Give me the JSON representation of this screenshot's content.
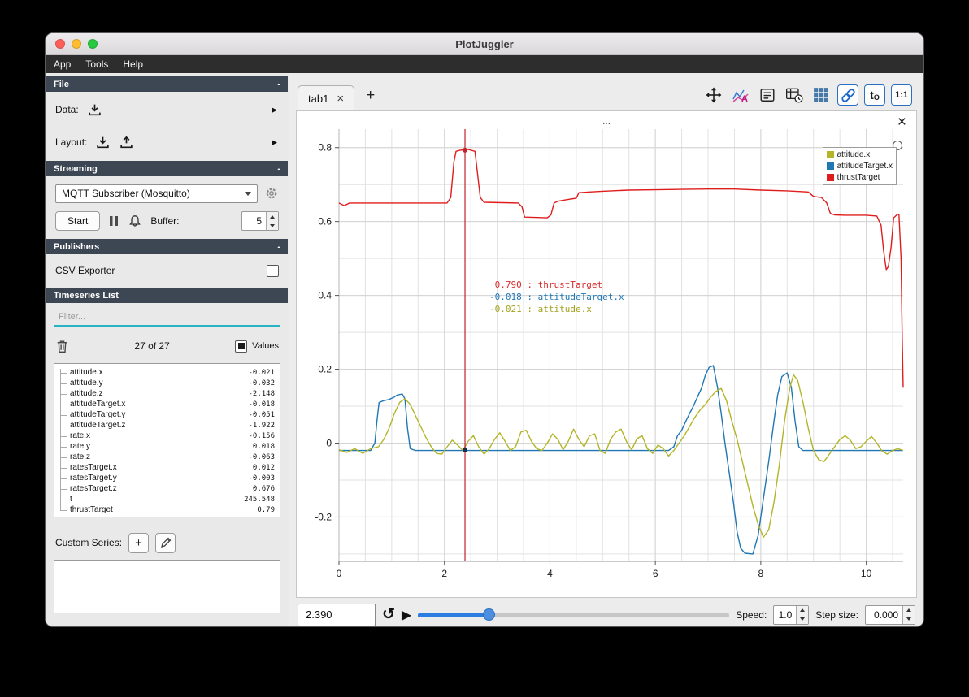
{
  "glyphs": {
    "minus": "-",
    "arrow_right": "▶",
    "close": "×",
    "add": "+",
    "play": "▶",
    "loop": "↺",
    "t0_main": "t",
    "t0_sub": "O",
    "ratio": "1:1"
  },
  "window": {
    "title": "PlotJuggler",
    "menu": [
      "App",
      "Tools",
      "Help"
    ]
  },
  "sidebar": {
    "file": {
      "title": "File",
      "data_label": "Data:",
      "layout_label": "Layout:"
    },
    "streaming": {
      "title": "Streaming",
      "source": "MQTT Subscriber (Mosquitto)",
      "start": "Start",
      "buffer_label": "Buffer:",
      "buffer_value": "5"
    },
    "publishers": {
      "title": "Publishers",
      "csv_exporter": "CSV Exporter"
    },
    "timeseries": {
      "title": "Timeseries List",
      "filter_placeholder": "Filter...",
      "count": "27 of 27",
      "values_label": "Values",
      "custom_series_label": "Custom Series:",
      "items": [
        {
          "name": "attitude.x",
          "value": "-0.021"
        },
        {
          "name": "attitude.y",
          "value": "-0.032"
        },
        {
          "name": "attitude.z",
          "value": "-2.148"
        },
        {
          "name": "attitudeTarget.x",
          "value": "-0.018"
        },
        {
          "name": "attitudeTarget.y",
          "value": "-0.051"
        },
        {
          "name": "attitudeTarget.z",
          "value": "-1.922"
        },
        {
          "name": "rate.x",
          "value": "-0.156"
        },
        {
          "name": "rate.y",
          "value": "0.018"
        },
        {
          "name": "rate.z",
          "value": "-0.063"
        },
        {
          "name": "ratesTarget.x",
          "value": "0.012"
        },
        {
          "name": "ratesTarget.y",
          "value": "-0.003"
        },
        {
          "name": "ratesTarget.z",
          "value": "0.676"
        },
        {
          "name": "t",
          "value": "245.548"
        },
        {
          "name": "thrustTarget",
          "value": "0.79"
        }
      ]
    }
  },
  "main": {
    "tab": {
      "label": "tab1"
    },
    "plot": {
      "title": "...",
      "legend": [
        {
          "label": "attitude.x",
          "color": "#b4b428"
        },
        {
          "label": "attitudeTarget.x",
          "color": "#1f77b4"
        },
        {
          "label": "thrustTarget",
          "color": "#e01d1d"
        }
      ],
      "tooltip": [
        {
          "value": "0.790",
          "label": "thrustTarget",
          "color": "#d92b2b"
        },
        {
          "value": "-0.018",
          "label": "attitudeTarget.x",
          "color": "#1f77b4"
        },
        {
          "value": "-0.021",
          "label": "attitude.x",
          "color": "#a2a21d"
        }
      ]
    },
    "playback": {
      "time": "2.390",
      "speed_label": "Speed:",
      "speed_value": "1.0",
      "step_label": "Step size:",
      "step_value": "0.000",
      "slider_fraction": 0.23
    }
  },
  "chart_data": {
    "type": "line",
    "title": "...",
    "xlabel": "",
    "ylabel": "",
    "xlim": [
      0,
      10.7
    ],
    "ylim": [
      -0.32,
      0.85
    ],
    "x_ticks": [
      0,
      2,
      4,
      6,
      8,
      10
    ],
    "y_ticks": [
      -0.2,
      0,
      0.2,
      0.4,
      0.6,
      0.8
    ],
    "x_minor_step": 0.5,
    "y_minor_step": 0.1,
    "grid": true,
    "legend_position": "top-right",
    "tracker": {
      "x": 2.39,
      "points": [
        {
          "y": 0.793,
          "color": "#c0242e"
        },
        {
          "y": -0.018,
          "color": "#16324f"
        }
      ]
    },
    "series": [
      {
        "name": "thrustTarget",
        "color": "#e01d1d",
        "points": [
          [
            0,
            0.65
          ],
          [
            0.1,
            0.643
          ],
          [
            0.2,
            0.65
          ],
          [
            1.0,
            0.65
          ],
          [
            2.05,
            0.65
          ],
          [
            2.12,
            0.665
          ],
          [
            2.18,
            0.762
          ],
          [
            2.22,
            0.79
          ],
          [
            2.3,
            0.793
          ],
          [
            2.45,
            0.795
          ],
          [
            2.58,
            0.79
          ],
          [
            2.62,
            0.74
          ],
          [
            2.68,
            0.665
          ],
          [
            2.75,
            0.652
          ],
          [
            3.4,
            0.65
          ],
          [
            3.47,
            0.64
          ],
          [
            3.52,
            0.612
          ],
          [
            3.95,
            0.61
          ],
          [
            4.02,
            0.618
          ],
          [
            4.08,
            0.65
          ],
          [
            4.15,
            0.655
          ],
          [
            4.35,
            0.66
          ],
          [
            4.5,
            0.663
          ],
          [
            4.55,
            0.678
          ],
          [
            4.75,
            0.68
          ],
          [
            5.0,
            0.682
          ],
          [
            5.5,
            0.685
          ],
          [
            6.0,
            0.686
          ],
          [
            6.5,
            0.687
          ],
          [
            7.0,
            0.688
          ],
          [
            7.5,
            0.688
          ],
          [
            8.0,
            0.685
          ],
          [
            8.5,
            0.683
          ],
          [
            8.9,
            0.68
          ],
          [
            9.0,
            0.668
          ],
          [
            9.15,
            0.665
          ],
          [
            9.25,
            0.65
          ],
          [
            9.32,
            0.622
          ],
          [
            9.4,
            0.618
          ],
          [
            9.6,
            0.617
          ],
          [
            10.0,
            0.617
          ],
          [
            10.2,
            0.615
          ],
          [
            10.28,
            0.59
          ],
          [
            10.33,
            0.52
          ],
          [
            10.38,
            0.47
          ],
          [
            10.42,
            0.478
          ],
          [
            10.47,
            0.53
          ],
          [
            10.52,
            0.61
          ],
          [
            10.58,
            0.618
          ],
          [
            10.62,
            0.62
          ],
          [
            10.66,
            0.5
          ],
          [
            10.68,
            0.3
          ],
          [
            10.7,
            0.15
          ]
        ]
      },
      {
        "name": "attitudeTarget.x",
        "color": "#1f77b4",
        "points": [
          [
            0,
            -0.02
          ],
          [
            0.6,
            -0.02
          ],
          [
            0.68,
            0.0
          ],
          [
            0.72,
            0.06
          ],
          [
            0.76,
            0.11
          ],
          [
            0.85,
            0.115
          ],
          [
            0.95,
            0.118
          ],
          [
            1.05,
            0.125
          ],
          [
            1.1,
            0.13
          ],
          [
            1.2,
            0.133
          ],
          [
            1.25,
            0.12
          ],
          [
            1.3,
            0.04
          ],
          [
            1.35,
            -0.015
          ],
          [
            1.45,
            -0.02
          ],
          [
            6.25,
            -0.02
          ],
          [
            6.35,
            -0.01
          ],
          [
            6.42,
            0.02
          ],
          [
            6.5,
            0.035
          ],
          [
            6.58,
            0.06
          ],
          [
            6.65,
            0.08
          ],
          [
            6.72,
            0.1
          ],
          [
            6.8,
            0.125
          ],
          [
            6.88,
            0.15
          ],
          [
            6.95,
            0.185
          ],
          [
            7.02,
            0.205
          ],
          [
            7.1,
            0.21
          ],
          [
            7.18,
            0.15
          ],
          [
            7.25,
            0.08
          ],
          [
            7.32,
            0.0
          ],
          [
            7.4,
            -0.08
          ],
          [
            7.48,
            -0.16
          ],
          [
            7.55,
            -0.24
          ],
          [
            7.62,
            -0.285
          ],
          [
            7.7,
            -0.298
          ],
          [
            7.85,
            -0.3
          ],
          [
            7.95,
            -0.25
          ],
          [
            8.05,
            -0.15
          ],
          [
            8.15,
            -0.05
          ],
          [
            8.25,
            0.06
          ],
          [
            8.32,
            0.13
          ],
          [
            8.4,
            0.18
          ],
          [
            8.5,
            0.19
          ],
          [
            8.58,
            0.15
          ],
          [
            8.65,
            0.06
          ],
          [
            8.72,
            -0.01
          ],
          [
            8.8,
            -0.02
          ],
          [
            10.7,
            -0.02
          ]
        ]
      },
      {
        "name": "attitude.x",
        "color": "#b4b428",
        "points": [
          [
            0,
            -0.018
          ],
          [
            0.15,
            -0.025
          ],
          [
            0.3,
            -0.015
          ],
          [
            0.45,
            -0.028
          ],
          [
            0.6,
            -0.015
          ],
          [
            0.75,
            -0.01
          ],
          [
            0.85,
            0.01
          ],
          [
            0.95,
            0.04
          ],
          [
            1.05,
            0.08
          ],
          [
            1.15,
            0.11
          ],
          [
            1.25,
            0.12
          ],
          [
            1.35,
            0.105
          ],
          [
            1.45,
            0.075
          ],
          [
            1.55,
            0.045
          ],
          [
            1.65,
            0.015
          ],
          [
            1.75,
            -0.01
          ],
          [
            1.85,
            -0.028
          ],
          [
            1.95,
            -0.03
          ],
          [
            2.05,
            -0.01
          ],
          [
            2.15,
            0.008
          ],
          [
            2.25,
            -0.005
          ],
          [
            2.35,
            -0.02
          ],
          [
            2.45,
            0.005
          ],
          [
            2.55,
            0.02
          ],
          [
            2.65,
            -0.01
          ],
          [
            2.75,
            -0.03
          ],
          [
            2.85,
            -0.015
          ],
          [
            2.95,
            0.01
          ],
          [
            3.05,
            0.028
          ],
          [
            3.15,
            0.005
          ],
          [
            3.25,
            -0.02
          ],
          [
            3.35,
            -0.01
          ],
          [
            3.45,
            0.03
          ],
          [
            3.55,
            0.035
          ],
          [
            3.65,
            0.005
          ],
          [
            3.75,
            -0.015
          ],
          [
            3.85,
            -0.02
          ],
          [
            3.95,
            0.0
          ],
          [
            4.05,
            0.025
          ],
          [
            4.15,
            0.01
          ],
          [
            4.25,
            -0.018
          ],
          [
            4.35,
            0.005
          ],
          [
            4.45,
            0.038
          ],
          [
            4.55,
            0.01
          ],
          [
            4.65,
            -0.01
          ],
          [
            4.75,
            0.02
          ],
          [
            4.85,
            0.025
          ],
          [
            4.95,
            -0.02
          ],
          [
            5.05,
            -0.028
          ],
          [
            5.15,
            0.01
          ],
          [
            5.25,
            0.03
          ],
          [
            5.35,
            0.038
          ],
          [
            5.45,
            0.005
          ],
          [
            5.55,
            -0.018
          ],
          [
            5.65,
            0.012
          ],
          [
            5.75,
            0.02
          ],
          [
            5.85,
            -0.015
          ],
          [
            5.95,
            -0.028
          ],
          [
            6.05,
            -0.005
          ],
          [
            6.15,
            -0.015
          ],
          [
            6.25,
            -0.035
          ],
          [
            6.35,
            -0.02
          ],
          [
            6.45,
            0.0
          ],
          [
            6.55,
            0.02
          ],
          [
            6.65,
            0.045
          ],
          [
            6.75,
            0.07
          ],
          [
            6.85,
            0.09
          ],
          [
            6.95,
            0.105
          ],
          [
            7.05,
            0.125
          ],
          [
            7.15,
            0.14
          ],
          [
            7.25,
            0.148
          ],
          [
            7.35,
            0.115
          ],
          [
            7.45,
            0.06
          ],
          [
            7.55,
            0.01
          ],
          [
            7.65,
            -0.05
          ],
          [
            7.75,
            -0.11
          ],
          [
            7.85,
            -0.17
          ],
          [
            7.95,
            -0.22
          ],
          [
            8.05,
            -0.255
          ],
          [
            8.15,
            -0.235
          ],
          [
            8.25,
            -0.16
          ],
          [
            8.35,
            -0.06
          ],
          [
            8.45,
            0.06
          ],
          [
            8.55,
            0.15
          ],
          [
            8.62,
            0.185
          ],
          [
            8.7,
            0.17
          ],
          [
            8.8,
            0.11
          ],
          [
            8.9,
            0.04
          ],
          [
            9.0,
            -0.02
          ],
          [
            9.1,
            -0.045
          ],
          [
            9.2,
            -0.05
          ],
          [
            9.3,
            -0.03
          ],
          [
            9.4,
            -0.01
          ],
          [
            9.5,
            0.01
          ],
          [
            9.6,
            0.02
          ],
          [
            9.7,
            0.008
          ],
          [
            9.8,
            -0.015
          ],
          [
            9.9,
            -0.01
          ],
          [
            10.0,
            0.005
          ],
          [
            10.1,
            0.018
          ],
          [
            10.2,
            0.0
          ],
          [
            10.3,
            -0.022
          ],
          [
            10.4,
            -0.03
          ],
          [
            10.5,
            -0.02
          ],
          [
            10.6,
            -0.015
          ],
          [
            10.7,
            -0.02
          ]
        ]
      }
    ]
  }
}
